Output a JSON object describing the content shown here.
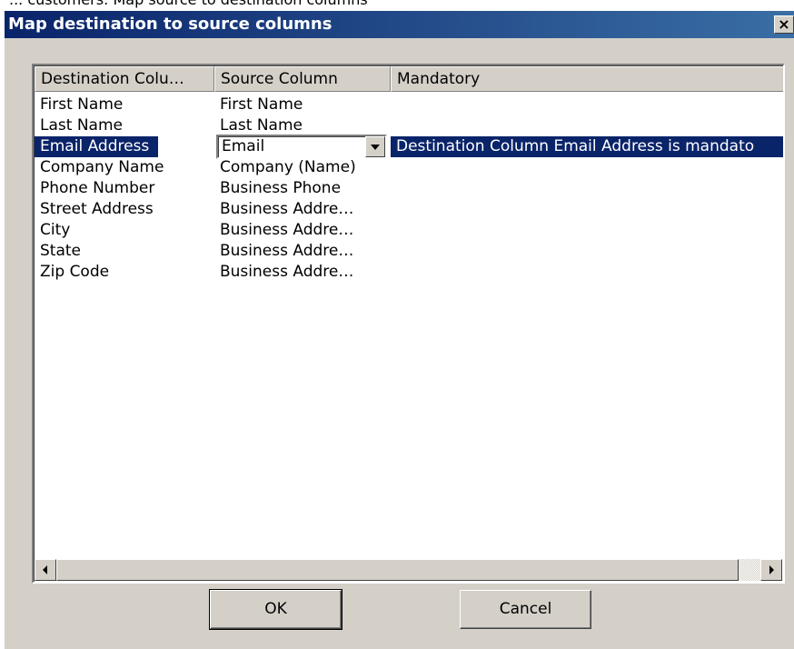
{
  "caption": "... customers: Map source to destination columns",
  "window": {
    "title": "Map destination to source columns",
    "close_label": "×"
  },
  "list": {
    "columns": [
      "Destination Colu…",
      "Source Column",
      "Mandatory"
    ],
    "rows": [
      {
        "destination": "First Name",
        "source": "First Name",
        "mandatory": ""
      },
      {
        "destination": "Last Name",
        "source": "Last Name",
        "mandatory": ""
      },
      {
        "destination": "Email Address",
        "source": "Email",
        "mandatory": "Destination Column Email Address is mandato"
      },
      {
        "destination": "Company Name",
        "source": "Company (Name)",
        "mandatory": ""
      },
      {
        "destination": "Phone Number",
        "source": "Business Phone",
        "mandatory": ""
      },
      {
        "destination": "Street Address",
        "source": "Business Addre…",
        "mandatory": ""
      },
      {
        "destination": "City",
        "source": "Business Addre…",
        "mandatory": ""
      },
      {
        "destination": "State",
        "source": "Business Addre…",
        "mandatory": ""
      },
      {
        "destination": "Zip Code",
        "source": "Business Addre…",
        "mandatory": ""
      }
    ],
    "selected_row": 2,
    "editor_value": "Email"
  },
  "buttons": {
    "ok": "OK",
    "cancel": "Cancel"
  },
  "colors": {
    "title_gradient_start": "#0a246a",
    "title_gradient_end": "#3a6ea5",
    "selection": "#0a246a",
    "dialog_face": "#d4d0c8"
  }
}
